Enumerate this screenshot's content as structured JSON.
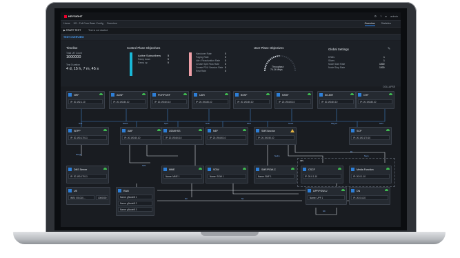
{
  "app": {
    "brand": "KEYSIGHT",
    "user": "admin",
    "accent": "#2d8cff",
    "brand_color": "#e4002b"
  },
  "breadcrumb": [
    "Home",
    "5G - Full Core Base Config",
    "Overview"
  ],
  "tabs": [
    {
      "label": "Overview",
      "active": true
    },
    {
      "label": "Statistics",
      "active": false
    }
  ],
  "actions": {
    "start_label": "▶ START TEST",
    "status": "Test is not started"
  },
  "section_title": "TEST OVERVIEW",
  "timeline": {
    "title": "Timeline",
    "total_label": "Total UE Count",
    "total_value": "1000000",
    "duration_label": "Test Duration",
    "duration_value": "4 d, 15 h, 7 m, 45 s"
  },
  "control_plane": {
    "title": "Control Plane Objectives",
    "rows": [
      {
        "label": "Active Subscribers",
        "value": "5"
      },
      {
        "label": "Ramp down",
        "value": "5"
      },
      {
        "label": "Ramp up",
        "value": "5"
      }
    ],
    "rates": [
      {
        "label": "Handover Rate",
        "value": "0"
      },
      {
        "label": "Paging Rate",
        "value": "0"
      },
      {
        "label": "Idle / Reactivation Rate",
        "value": "0"
      },
      {
        "label": "Create Split Flow Rate",
        "value": "0"
      },
      {
        "label": "Create PDU Session Rate",
        "value": "0"
      },
      {
        "label": "Rest Rate",
        "value": "0"
      }
    ],
    "bar_colors": [
      "#19b7d6",
      "#f0a0a8"
    ]
  },
  "user_plane": {
    "title": "User Plane Objectives",
    "gauge_label": "Throughput",
    "gauge_value": "76.24 Mbps"
  },
  "global_settings": {
    "title": "Global Settings",
    "rows": [
      {
        "label": "DNNs",
        "value": "1"
      },
      {
        "label": "Slices",
        "value": "1"
      },
      {
        "label": "Node Start Rate",
        "value": "1000"
      },
      {
        "label": "Node Stop Rate",
        "value": "1000"
      }
    ]
  },
  "diagram": {
    "collapse_label": "COLLAPSE",
    "top_row": [
      {
        "name": "NRF",
        "ip": "IP: 20.192.1.10"
      },
      {
        "name": "AUSF",
        "ip": "IP: 20.190.80.10"
      },
      {
        "name": "PCF/PCRF",
        "ip": "IP: 20.190.80.10"
      },
      {
        "name": "UDR",
        "ip": "IP: 20.190.80.10"
      },
      {
        "name": "BSSF",
        "ip": "IP: 20.190.80.10"
      },
      {
        "name": "NSSF",
        "ip": "IP: 20.190.80.10"
      },
      {
        "name": "5G-EIR",
        "ip": "IP: 20.190.80.10"
      },
      {
        "name": "CHF",
        "ip": "IP: 20.190.80.10"
      }
    ],
    "mid_row": [
      {
        "name": "SEPP",
        "ip": "IP: 20.190.170.11",
        "status": "ok"
      },
      {
        "name": "AMF",
        "ip": "IP: 20.190.60.10",
        "status": "ok"
      },
      {
        "name": "UDM/HSS",
        "ip": "IP: 20.190.80.10",
        "status": "ok"
      },
      {
        "name": "NEF",
        "ip": "IP: 20.190.80.10",
        "status": "ok"
      },
      {
        "name": "SMF/Anchor",
        "ip": "IP: 20.190.50.10",
        "status": "warn"
      },
      {
        "name": "SCP",
        "ip": "IP: 20.190.170.10",
        "status": "ok"
      }
    ],
    "low_row": [
      {
        "name": "DNS Server",
        "ip": "IP: 20.190.170.11"
      },
      {
        "name": "MME",
        "ip": "Name: MME 1"
      },
      {
        "name": "SGW",
        "ip": "Name: SGW 1"
      },
      {
        "name": "SMF/PGW-C",
        "ip": "Name: SMF 1"
      },
      {
        "name": "CSCF",
        "ip": "IP: 20.0.1.10"
      },
      {
        "name": "Media Function",
        "ip": "IP: 20.0.1.10"
      }
    ],
    "ue": {
      "name": "UE",
      "value": "IMSI: 001010...",
      "count": "1000000"
    },
    "ran": {
      "name": "RAN",
      "rows": [
        "Name: gNodeB 1",
        "Name: gNodeB 2",
        "Name: gNodeB 3"
      ]
    },
    "upf": {
      "name": "UPF/PGW-U",
      "ip": "Name: UPF 1"
    },
    "dn": {
      "name": "DN",
      "ip": "IP: 20.0.4.10"
    },
    "link_labels": [
      "Nnrf",
      "Nausf",
      "Npcf",
      "Nudr",
      "Nbsf",
      "Nnssf",
      "N5g-eir",
      "Nchf",
      "Nsepp",
      "Namf",
      "Nudm",
      "Nnef",
      "Nsmf",
      "Nscp",
      "N26",
      "S11",
      "N4",
      "N2",
      "N3",
      "N6",
      "N9",
      "Rx",
      "N1",
      "Gx",
      "Nudm"
    ],
    "ims_label": "IMS"
  }
}
